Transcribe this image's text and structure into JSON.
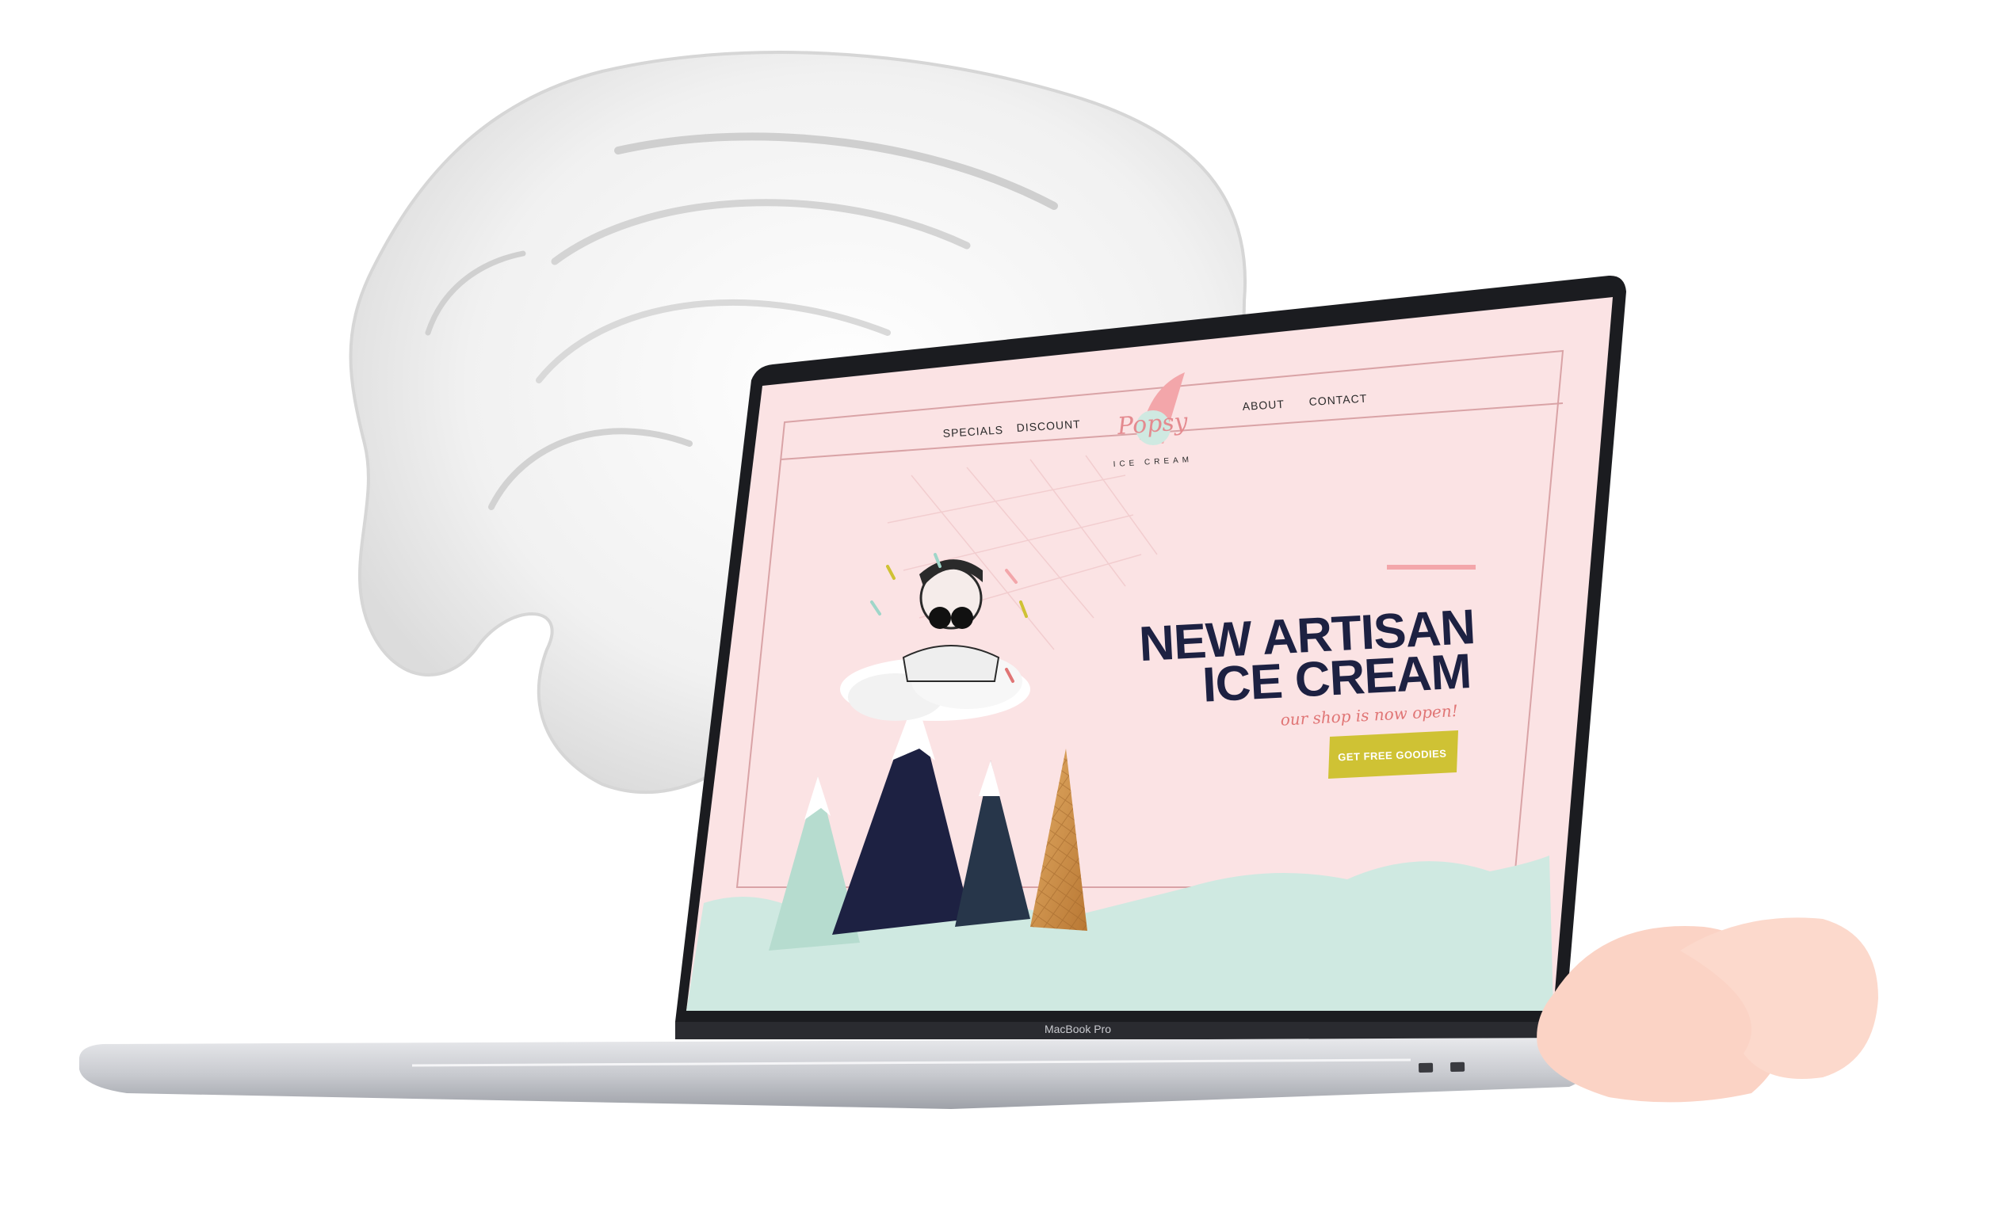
{
  "site": {
    "brand_script": "Popsy",
    "brand_sub": "ICE CREAM",
    "nav_left": [
      "SPECIALS",
      "DISCOUNT"
    ],
    "nav_right": [
      "ABOUT",
      "CONTACT"
    ]
  },
  "hero": {
    "title_line1": "NEW ARTISAN",
    "title_line2": "ICE CREAM",
    "tagline": "our shop is now open!",
    "cta_label": "GET FREE GOODIES"
  },
  "device": {
    "label": "MacBook Pro"
  },
  "colors": {
    "screen_bg": "#fbe3e4",
    "mint": "#cfe9e1",
    "navy": "#1d2142",
    "mustard": "#cfc234",
    "pink_accent": "#f3a6aa",
    "peach_swatch": "#fbd3c5"
  }
}
